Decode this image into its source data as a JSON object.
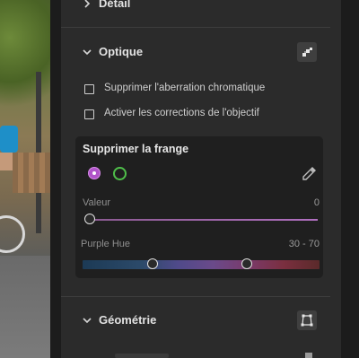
{
  "sections": {
    "detail": {
      "title": "Détail"
    },
    "optique": {
      "title": "Optique",
      "checkbox_ca": "Supprimer l'aberration chromatique",
      "checkbox_profile": "Activer les corrections de l'objectif"
    },
    "frange": {
      "title": "Supprimer la frange",
      "valeur_label": "Valeur",
      "valeur_value": "0",
      "hue_label": "Purple Hue",
      "hue_value": "30 - 70"
    },
    "geometrie": {
      "title": "Géométrie"
    }
  },
  "colors": {
    "purple_swatch": "#b054c9",
    "green_swatch": "#4fbf4a"
  }
}
